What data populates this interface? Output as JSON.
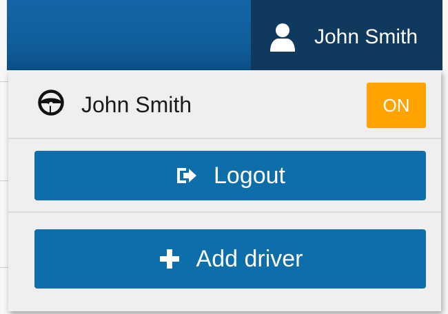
{
  "header": {
    "user_name": "John Smith",
    "user_icon": "user-icon"
  },
  "dropdown": {
    "driver": {
      "icon": "steering-wheel-icon",
      "name": "John Smith",
      "status": "ON",
      "status_color": "#ffa300"
    },
    "logout": {
      "icon": "logout-icon",
      "label": "Logout"
    },
    "add_driver": {
      "icon": "plus-icon",
      "label": "Add driver"
    }
  },
  "colors": {
    "header": "#1565a6",
    "user_toggle": "#0f3a5e",
    "button": "#0d6ea9",
    "dropdown_bg": "#efefef"
  }
}
